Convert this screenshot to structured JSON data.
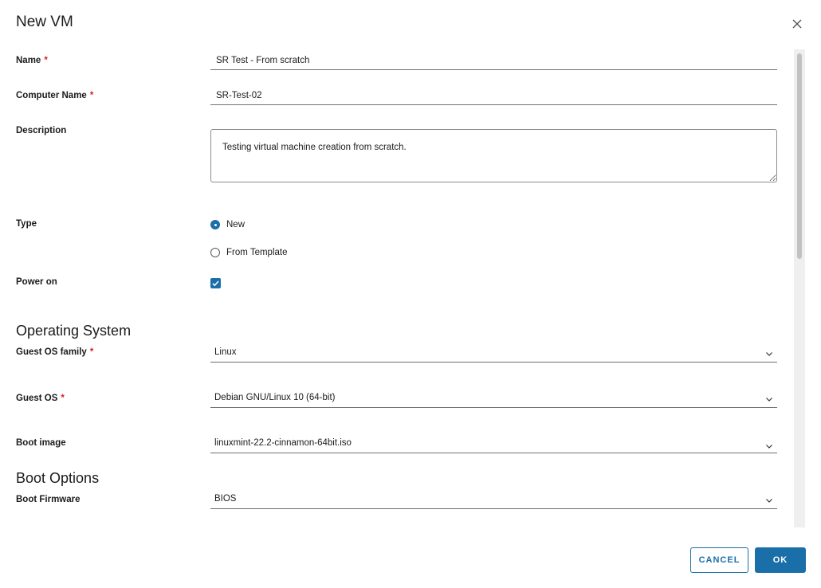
{
  "dialog": {
    "title": "New VM"
  },
  "form": {
    "name": {
      "label": "Name",
      "value": "SR Test - From scratch"
    },
    "computer_name": {
      "label": "Computer Name",
      "value": "SR-Test-02"
    },
    "description": {
      "label": "Description",
      "value": "Testing virtual machine creation from scratch."
    },
    "type": {
      "label": "Type",
      "options": [
        "New",
        "From Template"
      ],
      "selected": "New"
    },
    "power_on": {
      "label": "Power on",
      "checked": true
    },
    "required_marker": "*"
  },
  "operating_system": {
    "heading": "Operating System",
    "guest_os_family": {
      "label": "Guest OS family",
      "value": "Linux"
    },
    "guest_os": {
      "label": "Guest OS",
      "value": "Debian GNU/Linux 10 (64-bit)"
    },
    "boot_image": {
      "label": "Boot image",
      "value": "linuxmint-22.2-cinnamon-64bit.iso"
    }
  },
  "boot_options": {
    "heading": "Boot Options",
    "boot_firmware": {
      "label": "Boot Firmware",
      "value": "BIOS"
    }
  },
  "footer": {
    "cancel_label": "CANCEL",
    "ok_label": "OK"
  },
  "colors": {
    "accent": "#1a6fa8",
    "required": "#d61f1f"
  },
  "icons": [
    "close-icon",
    "chevron-down-icon",
    "check-icon"
  ]
}
